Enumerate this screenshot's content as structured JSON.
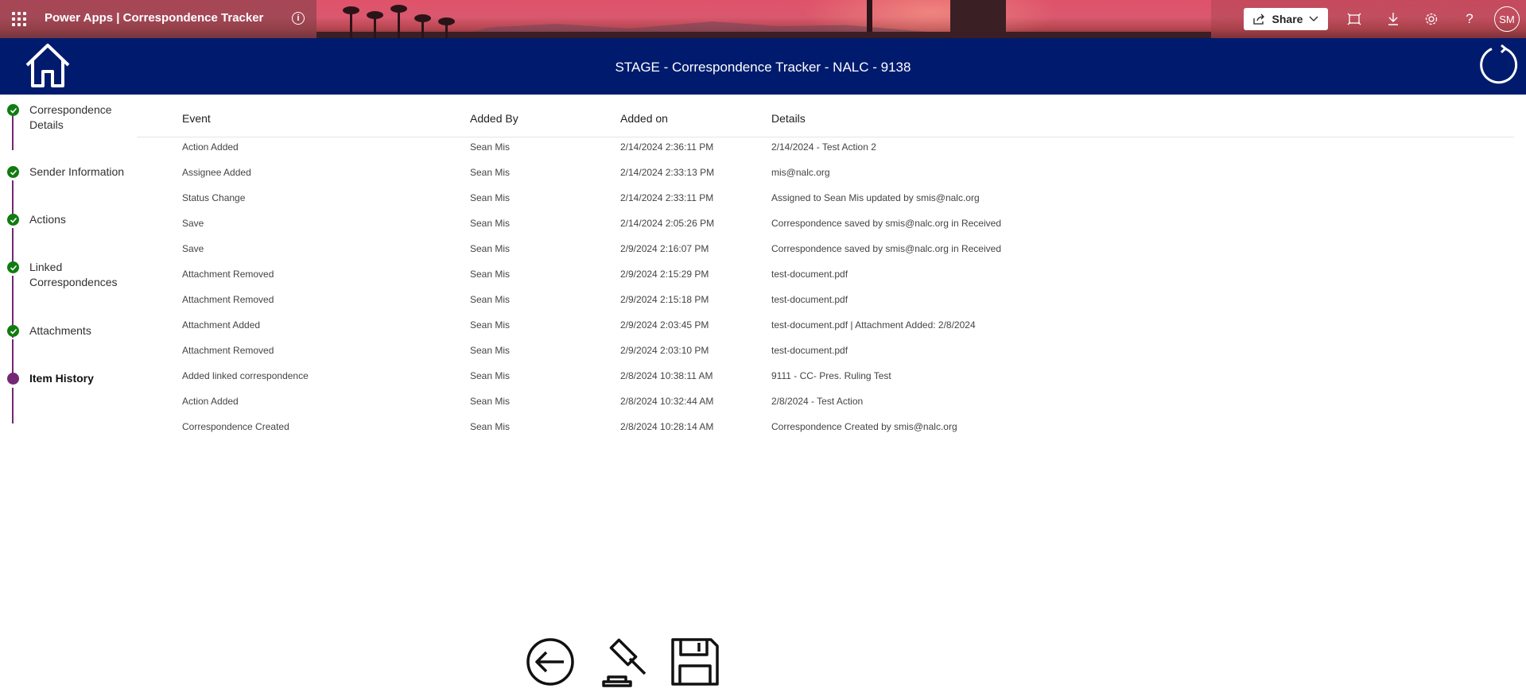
{
  "topbar": {
    "app_title": "Power Apps  |  Correspondence Tracker",
    "share_label": "Share",
    "avatar_initials": "SM",
    "icons": [
      "apps-waffle-icon",
      "info-icon",
      "share-icon",
      "chevron-down-icon",
      "fit-to-screen-icon",
      "download-icon",
      "settings-gear-icon",
      "help-question-icon"
    ]
  },
  "header": {
    "title": "STAGE - Correspondence Tracker  - NALC - 9138",
    "icons": [
      "home-icon",
      "refresh-icon"
    ]
  },
  "steps": [
    {
      "label": "Correspondence Details",
      "status": "complete"
    },
    {
      "label": "Sender Information",
      "status": "complete"
    },
    {
      "label": "Actions",
      "status": "complete"
    },
    {
      "label": "Linked Correspondences",
      "status": "complete"
    },
    {
      "label": "Attachments",
      "status": "complete"
    },
    {
      "label": "Item History",
      "status": "current"
    }
  ],
  "table": {
    "columns": [
      "Event",
      "Added By",
      "Added on",
      "Details"
    ],
    "rows": [
      [
        "Action Added",
        "Sean Mis",
        "2/14/2024 2:36:11 PM",
        "2/14/2024 - Test Action 2"
      ],
      [
        "Assignee Added",
        "Sean Mis",
        "2/14/2024 2:33:13 PM",
        "mis@nalc.org"
      ],
      [
        "Status Change",
        "Sean Mis",
        "2/14/2024 2:33:11 PM",
        "Assigned to Sean Mis updated by smis@nalc.org"
      ],
      [
        "Save",
        "Sean Mis",
        "2/14/2024 2:05:26 PM",
        "Correspondence saved by smis@nalc.org in Received"
      ],
      [
        "Save",
        "Sean Mis",
        "2/9/2024 2:16:07 PM",
        "Correspondence saved by smis@nalc.org in Received"
      ],
      [
        "Attachment Removed",
        "Sean Mis",
        "2/9/2024 2:15:29 PM",
        "test-document.pdf"
      ],
      [
        "Attachment Removed",
        "Sean Mis",
        "2/9/2024 2:15:18 PM",
        "test-document.pdf"
      ],
      [
        "Attachment Added",
        "Sean Mis",
        "2/9/2024 2:03:45 PM",
        "test-document.pdf | Attachment Added: 2/8/2024"
      ],
      [
        "Attachment Removed",
        "Sean Mis",
        "2/9/2024 2:03:10 PM",
        "test-document.pdf"
      ],
      [
        "Added linked correspondence",
        "Sean Mis",
        "2/8/2024 10:38:11 AM",
        "9111 - CC- Pres. Ruling Test"
      ],
      [
        "Action Added",
        "Sean Mis",
        "2/8/2024 10:32:44 AM",
        "2/8/2024 - Test Action"
      ],
      [
        "Correspondence Created",
        "Sean Mis",
        "2/8/2024 10:28:14 AM",
        "Correspondence Created by smis@nalc.org"
      ]
    ]
  },
  "bottom_actions": [
    "back-arrow-icon",
    "gavel-icon",
    "save-floppy-icon"
  ],
  "colors": {
    "header_blue": "#001b6e",
    "step_complete_green": "#107c10",
    "step_current_purple": "#742774",
    "connector_purple": "#742774"
  }
}
